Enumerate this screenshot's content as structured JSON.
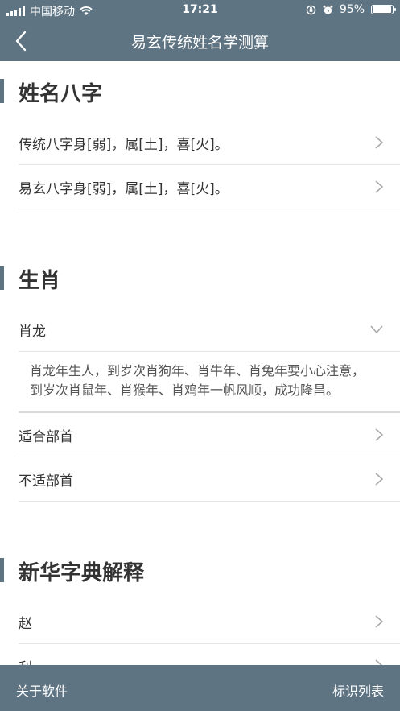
{
  "status_bar": {
    "carrier": "中国移动",
    "time": "17:21",
    "battery_percent": "95%",
    "battery_level": 0.95
  },
  "nav": {
    "title": "易玄传统姓名学测算"
  },
  "sections": {
    "bazi": {
      "title": "姓名八字",
      "rows": [
        "传统八字身[弱]，属[土]，喜[火]。",
        "易玄八字身[弱]，属[土]，喜[火]。"
      ]
    },
    "zodiac": {
      "title": "生肖",
      "expanded_row": "肖龙",
      "expanded_text": "肖龙年生人，到岁次肖狗年、肖牛年、肖兔年要小心注意，到岁次肖鼠年、肖猴年、肖鸡年一帆风顺，成功隆昌。",
      "rows": [
        "适合部首",
        "不适部首"
      ]
    },
    "dictionary": {
      "title": "新华字典解释",
      "rows": [
        "赵",
        "利"
      ]
    }
  },
  "bottom_bar": {
    "left_label": "关于软件",
    "right_label": "标识列表"
  }
}
